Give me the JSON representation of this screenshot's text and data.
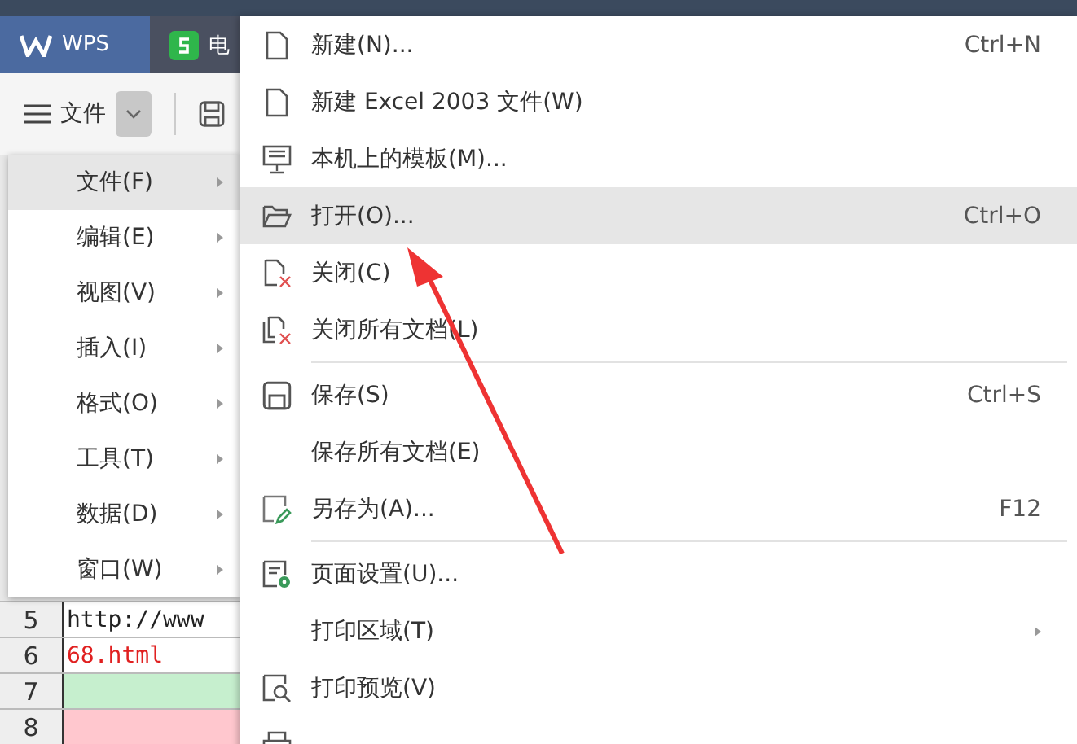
{
  "tabs": [
    {
      "label": "WPS",
      "kind": "home",
      "selected": true
    },
    {
      "label": "电",
      "kind": "sheet",
      "selected": false
    }
  ],
  "toolbar": {
    "menu_label": "文件"
  },
  "side_menu": [
    {
      "label": "文件(F)",
      "selected": true
    },
    {
      "label": "编辑(E)",
      "selected": false
    },
    {
      "label": "视图(V)",
      "selected": false
    },
    {
      "label": "插入(I)",
      "selected": false
    },
    {
      "label": "格式(O)",
      "selected": false
    },
    {
      "label": "工具(T)",
      "selected": false
    },
    {
      "label": "数据(D)",
      "selected": false
    },
    {
      "label": "窗口(W)",
      "selected": false
    }
  ],
  "file_menu": [
    {
      "kind": "doc",
      "label": "新建(N)...",
      "shortcut": "Ctrl+N",
      "selected": false
    },
    {
      "kind": "doc",
      "label": "新建 Excel 2003 文件(W)",
      "selected": false
    },
    {
      "kind": "monitor",
      "label": "本机上的模板(M)...",
      "selected": false
    },
    {
      "kind": "folder",
      "label": "打开(O)...",
      "shortcut": "Ctrl+O",
      "selected": true
    },
    {
      "kind": "close",
      "label": "关闭(C)",
      "selected": false
    },
    {
      "kind": "closeall",
      "label": "关闭所有文档(L)",
      "selected": false
    },
    {
      "kind": "separator"
    },
    {
      "kind": "save",
      "label": "保存(S)",
      "shortcut": "Ctrl+S",
      "selected": false
    },
    {
      "kind": "plain",
      "label": "保存所有文档(E)",
      "selected": false
    },
    {
      "kind": "saveas",
      "label": "另存为(A)...",
      "shortcut": "F12",
      "selected": false
    },
    {
      "kind": "separator"
    },
    {
      "kind": "setup",
      "label": "页面设置(U)...",
      "selected": false
    },
    {
      "kind": "plain",
      "label": "打印区域(T)",
      "submenu": true,
      "selected": false
    },
    {
      "kind": "preview",
      "label": "打印预览(V)",
      "selected": false
    },
    {
      "kind": "print",
      "selected": false
    }
  ],
  "sheet_rows": [
    {
      "number": "5",
      "kind": "plain",
      "text": "http://www"
    },
    {
      "number": "6",
      "kind": "link",
      "text": "68.html"
    },
    {
      "number": "7",
      "kind": "fill",
      "color": "#c6efce"
    },
    {
      "number": "8",
      "kind": "fill",
      "color": "#ffc7ce"
    }
  ]
}
